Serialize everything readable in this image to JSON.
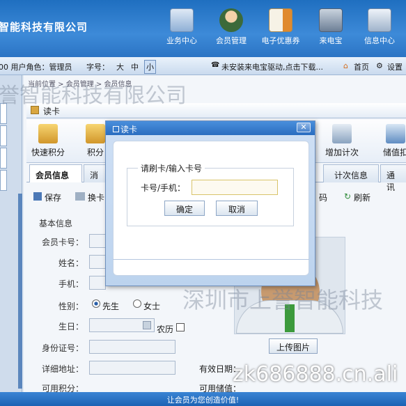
{
  "header": {
    "company": "智能科技有限公司",
    "nav": [
      {
        "label": "业务中心",
        "icon": "business-center-icon"
      },
      {
        "label": "会员管理",
        "icon": "member-management-icon"
      },
      {
        "label": "电子优惠券",
        "icon": "coupon-icon"
      },
      {
        "label": "来电宝",
        "icon": "phone-icon"
      },
      {
        "label": "信息中心",
        "icon": "info-center-icon"
      }
    ]
  },
  "infobar": {
    "user": "00  用户角色：管理员",
    "fontsize_label": "字号：",
    "fontsize_options": [
      "大",
      "中",
      "小"
    ],
    "notice": "未安装来电宝驱动,点击下载...",
    "home": "首页",
    "settings": "设置"
  },
  "breadcrumb": "当前位置 > 会员管理 > 会员信息",
  "window": {
    "title": "读卡"
  },
  "toolbar1": [
    {
      "label": "快速积分",
      "icon": "quick-points-icon"
    },
    {
      "label": "积分",
      "icon": "points-icon"
    },
    {
      "label": "增加计次",
      "icon": "add-count-icon"
    },
    {
      "label": "储值扣",
      "icon": "stored-value-icon"
    }
  ],
  "tabs": [
    "会员信息",
    "消",
    "计次信息",
    "通讯"
  ],
  "toolbar2": {
    "save": "保存",
    "swap_card": "换卡",
    "password": "码",
    "refresh": "刷新"
  },
  "form": {
    "section": "基本信息",
    "labels": [
      "会员卡号：",
      "姓名：",
      "手机：",
      "性别：",
      "生日：",
      "身份证号：",
      "详细地址：",
      "可用积分："
    ],
    "gender_options": [
      "先生",
      "女士"
    ],
    "lunar": "农历",
    "expiry": "有效日期：",
    "balance": "可用储值："
  },
  "upload_button": "上传图片",
  "watermarks": {
    "top": "誉智能科技有限公司",
    "mid": "深圳市上誉智能科技",
    "url": "zk686888.cn.ali"
  },
  "modal": {
    "title": "读卡",
    "legend": "请刷卡/输入卡号",
    "card_label": "卡号/手机：",
    "card_value": "",
    "ok": "确定",
    "cancel": "取消"
  },
  "footer": "让会员为您创造价值!"
}
